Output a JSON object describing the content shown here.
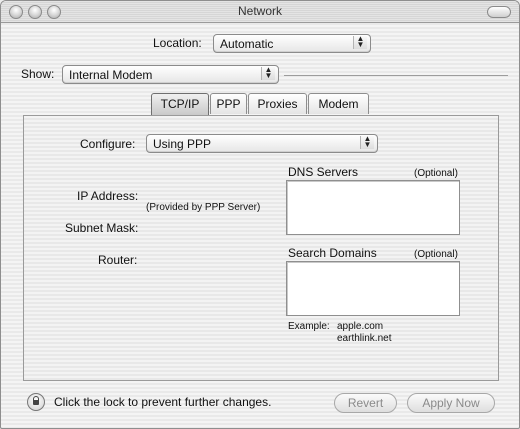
{
  "window": {
    "title": "Network"
  },
  "location": {
    "label": "Location:",
    "value": "Automatic"
  },
  "show": {
    "label": "Show:",
    "value": "Internal Modem"
  },
  "tabs": [
    {
      "label": "TCP/IP",
      "selected": true
    },
    {
      "label": "PPP",
      "selected": false
    },
    {
      "label": "Proxies",
      "selected": false
    },
    {
      "label": "Modem",
      "selected": false
    }
  ],
  "configure": {
    "label": "Configure:",
    "value": "Using PPP"
  },
  "fields": {
    "ip_address_label": "IP Address:",
    "provided_note": "(Provided by PPP Server)",
    "subnet_mask_label": "Subnet Mask:",
    "router_label": "Router:"
  },
  "dns": {
    "label": "DNS Servers",
    "optional": "(Optional)",
    "value": ""
  },
  "search_domains": {
    "label": "Search Domains",
    "optional": "(Optional)",
    "value": ""
  },
  "example": {
    "label": "Example:",
    "line1": "apple.com",
    "line2": "earthlink.net"
  },
  "lock_text": "Click the lock to prevent further changes.",
  "buttons": {
    "revert": "Revert",
    "apply": "Apply Now"
  }
}
